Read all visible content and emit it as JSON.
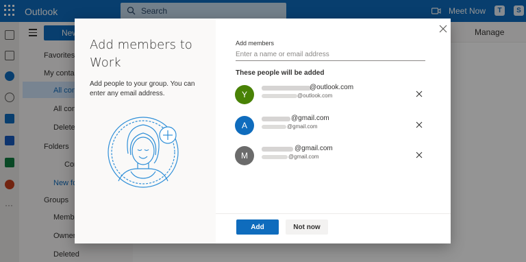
{
  "app": {
    "title": "Outlook"
  },
  "topbar": {
    "search_placeholder": "Search",
    "meet_now_label": "Meet Now",
    "icons": [
      "waffle-icon",
      "search-icon",
      "video-icon",
      "teams-icon",
      "skype-icon"
    ]
  },
  "commandbar": {
    "new_label": "New",
    "manage_label": "Manage"
  },
  "sidebar": {
    "items": [
      {
        "label": "Favorites",
        "icon": "star-icon"
      },
      {
        "label": "My contac",
        "icon": "chevron-down-icon"
      },
      {
        "label": "All con",
        "icon": "person-icon",
        "selected": true
      },
      {
        "label": "All con",
        "icon": "people-icon"
      },
      {
        "label": "Deleted",
        "icon": "trash-icon"
      },
      {
        "label": "Folders",
        "icon": "chevron-down-icon"
      },
      {
        "label": "Con",
        "icon": "folder-icon"
      },
      {
        "label": "New fo",
        "icon": ""
      },
      {
        "label": "Groups",
        "icon": "chevron-down-icon"
      },
      {
        "label": "Member",
        "icon": "people-icon"
      },
      {
        "label": "Owner",
        "icon": "people-icon"
      },
      {
        "label": "Deleted",
        "icon": "trash-icon"
      }
    ]
  },
  "modal": {
    "title": "Add members to Work",
    "description": "Add people to your group. You can enter any email address.",
    "add_members_label": "Add members",
    "input_placeholder": "Enter a name or email address",
    "people_heading": "These people will be added",
    "people": [
      {
        "initial": "Y",
        "color": "#498205",
        "primary": "@outlook.com",
        "secondary": "@outlook.com"
      },
      {
        "initial": "A",
        "color": "#0f6cbd",
        "primary": "@gmail.com",
        "secondary": "@gmail.com"
      },
      {
        "initial": "M",
        "color": "#6b6b6b",
        "primary": "@gmail.com",
        "secondary": "@gmail.com"
      }
    ],
    "add_button": "Add",
    "not_now_button": "Not now"
  },
  "colors": {
    "brand": "#0f6cbd",
    "overlay": "rgba(0,0,0,0.42)"
  }
}
